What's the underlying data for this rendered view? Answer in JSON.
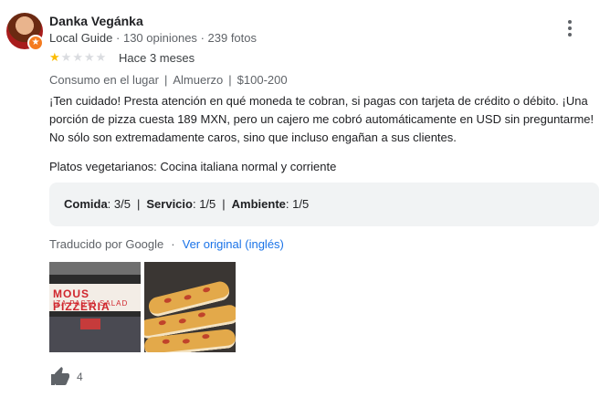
{
  "review": {
    "author_name": "Danka Vegánka",
    "local_guide_label": "Local Guide",
    "review_count": "130 opiniones",
    "photo_count": "239 fotos",
    "rating": 1,
    "rating_max": 5,
    "time_ago": "Hace 3 meses",
    "tags": [
      "Consumo en el lugar",
      "Almuerzo",
      "$100-200"
    ],
    "text": "¡Ten cuidado! Presta atención en qué moneda te cobran, si pagas con tarjeta de crédito o débito. ¡Una porción de pizza cuesta 189 MXN, pero un cajero me cobró automáticamente en USD sin preguntarme! No sólo son extremadamente caros, sino que incluso engañan a sus clientes.",
    "vegetarian_note": "Platos vegetarianos: Cocina italiana normal y corriente",
    "ratings": {
      "food_label": "Comida",
      "food_value": "3/5",
      "service_label": "Servicio",
      "service_value": "1/5",
      "ambience_label": "Ambiente",
      "ambience_value": "1/5"
    },
    "translated_by": "Traducido por Google",
    "original_link": "Ver original (inglés)",
    "photos": [
      {
        "sign_line1": "MOUS PIZZERIA",
        "sign_line2": "IZA PASTA SALAD"
      },
      {
        "description_icon": "pizza-slices-photo"
      }
    ],
    "like_count": "4"
  },
  "colors": {
    "star_on": "#fbbc04",
    "star_off": "#dadce0",
    "link": "#1a73e8",
    "badge": "#f47b20"
  }
}
